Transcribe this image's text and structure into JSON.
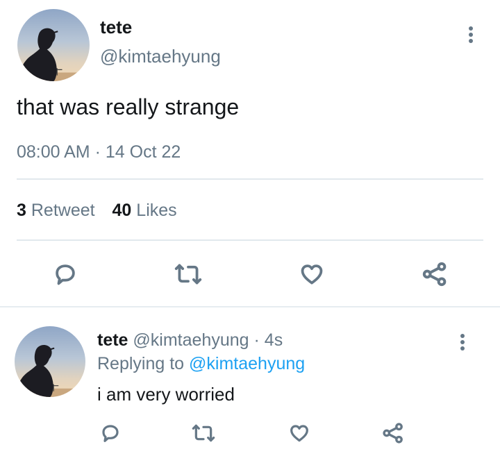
{
  "main_tweet": {
    "display_name": "tete",
    "handle": "@kimtaehyung",
    "text": "that was really strange",
    "time": "08:00 AM",
    "separator": "·",
    "date": "14 Oct 22",
    "retweet_count": "3",
    "retweet_label": "Retweet",
    "likes_count": "40",
    "likes_label": "Likes"
  },
  "reply_tweet": {
    "display_name": "tete",
    "handle": "@kimtaehyung",
    "separator": "·",
    "time_ago": "4s",
    "replying_prefix": "Replying to",
    "replying_handle": "@kimtaehyung",
    "text": "i am very worried"
  },
  "colors": {
    "text": "#14171a",
    "muted": "#657786",
    "link": "#1da1f2",
    "divider": "#e1e8ed"
  },
  "icons": [
    "more-vertical-icon",
    "reply-icon",
    "retweet-icon",
    "like-icon",
    "share-icon"
  ]
}
